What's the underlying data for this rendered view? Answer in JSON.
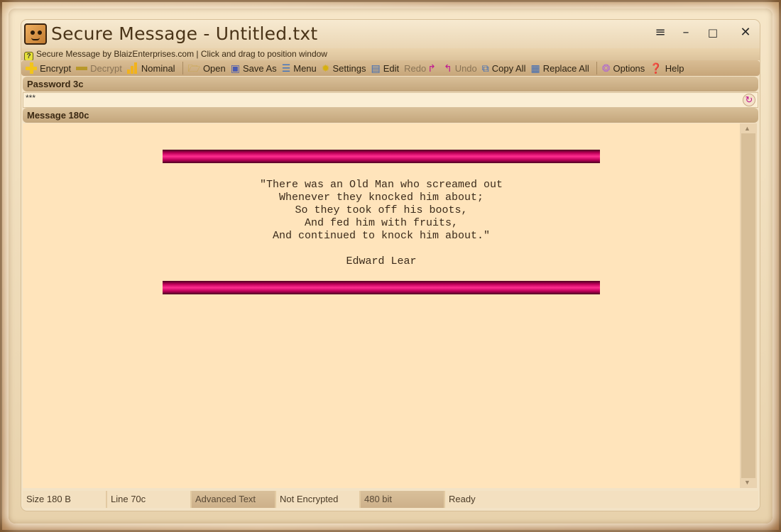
{
  "window": {
    "title": "Secure Message - Untitled.txt",
    "info_line": "Secure Message by BlaizEnterprises.com | Click and drag to position window",
    "controls": {
      "menu": "≡",
      "minimize": "–",
      "maximize": "□",
      "close": "✕"
    }
  },
  "toolbar": {
    "encrypt": "Encrypt",
    "decrypt": "Decrypt",
    "nominal": "Nominal",
    "open": "Open",
    "save_as": "Save As",
    "menu": "Menu",
    "settings": "Settings",
    "edit": "Edit",
    "redo": "Redo",
    "undo": "Undo",
    "copy_all": "Copy All",
    "replace_all": "Replace All",
    "options": "Options",
    "help": "Help"
  },
  "password": {
    "header": "Password 3c",
    "value": "***"
  },
  "message": {
    "header": "Message 180c",
    "poem": "\"There was an Old Man who screamed out\nWhenever they knocked him about;\nSo they took off his boots,\nAnd fed him with fruits,\nAnd continued to knock him about.\"",
    "author": "Edward Lear"
  },
  "status": {
    "size": "Size 180 B",
    "line": "Line 70c",
    "mode": "Advanced Text",
    "encryption": "Not Encrypted",
    "bits": "480 bit",
    "state": "Ready"
  },
  "colors": {
    "accent_bar": "#e0107a",
    "message_bg": "#ffe4bb"
  }
}
